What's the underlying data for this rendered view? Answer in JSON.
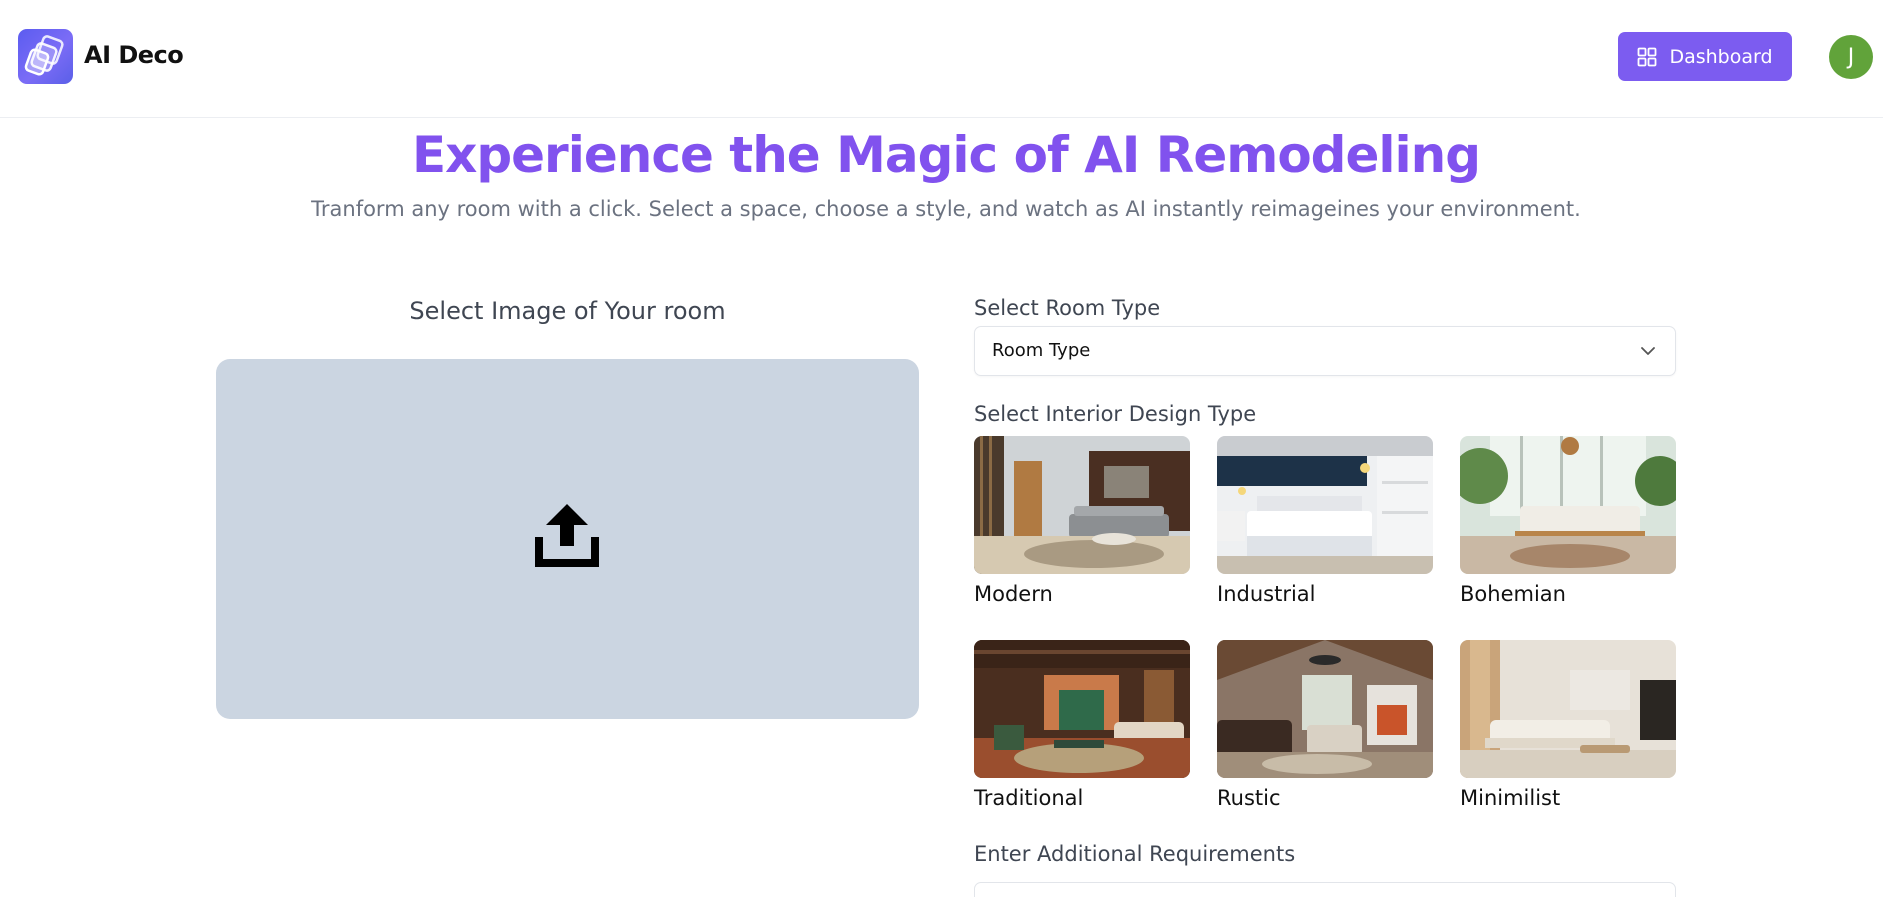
{
  "header": {
    "app_name": "AI Deco",
    "dashboard_label": "Dashboard",
    "avatar_initial": "J"
  },
  "hero": {
    "title": "Experience the Magic of AI Remodeling",
    "subtitle": "Tranform any room with a click. Select a space, choose a style, and watch as AI instantly reimageines your environment."
  },
  "upload": {
    "label": "Select Image of Your room",
    "icon": "upload-icon"
  },
  "room_type": {
    "label": "Select Room Type",
    "selected": "Room Type"
  },
  "design": {
    "label": "Select Interior Design Type",
    "types": [
      {
        "name": "Modern"
      },
      {
        "name": "Industrial"
      },
      {
        "name": "Bohemian"
      },
      {
        "name": "Traditional"
      },
      {
        "name": "Rustic"
      },
      {
        "name": "Minimilist"
      }
    ]
  },
  "requirements": {
    "label": "Enter Additional Requirements"
  },
  "colors": {
    "accent": "#8152ee",
    "button": "#7c5cf0",
    "avatar": "#61a33a",
    "upload_area": "#cbd5e1"
  }
}
